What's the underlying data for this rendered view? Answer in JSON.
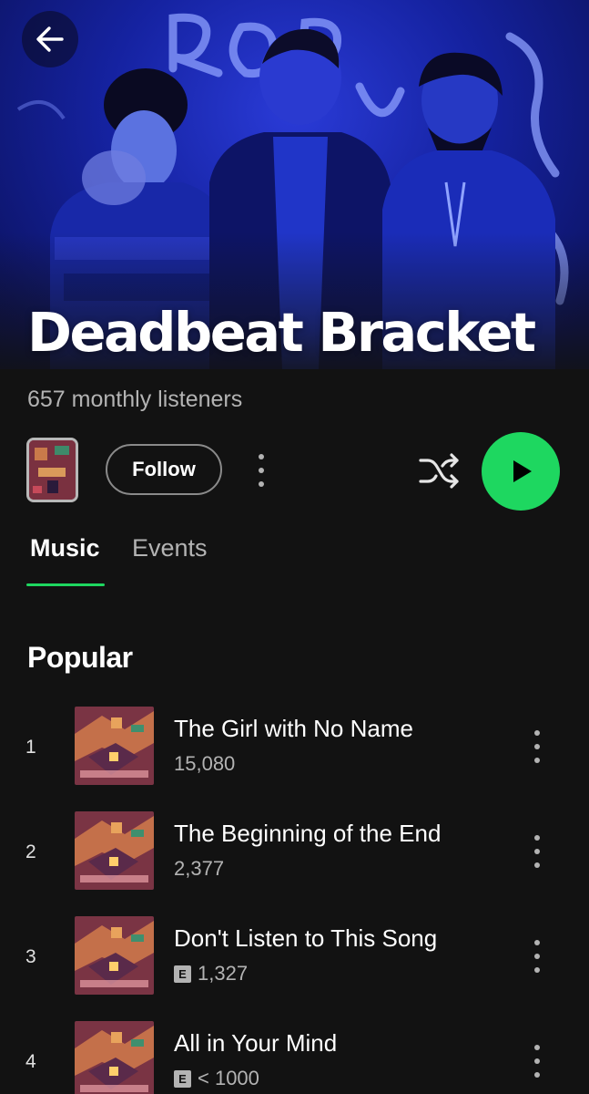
{
  "artist": {
    "name": "Deadbeat Bracket",
    "monthly_listeners": "657 monthly listeners"
  },
  "controls": {
    "follow_label": "Follow"
  },
  "icons": {
    "back": "arrow-left-icon",
    "more": "more-vertical-icon",
    "shuffle": "shuffle-icon",
    "play": "play-icon"
  },
  "tabs": [
    {
      "label": "Music",
      "active": true
    },
    {
      "label": "Events",
      "active": false
    }
  ],
  "popular": {
    "title": "Popular",
    "tracks": [
      {
        "rank": "1",
        "title": "The Girl with No Name",
        "plays": "15,080",
        "explicit": false
      },
      {
        "rank": "2",
        "title": "The Beginning of the End",
        "plays": "2,377",
        "explicit": false
      },
      {
        "rank": "3",
        "title": "Don't Listen to This Song",
        "plays": "1,327",
        "explicit": true,
        "explicit_label": "E"
      },
      {
        "rank": "4",
        "title": "All in Your Mind",
        "plays": "< 1000",
        "explicit": true,
        "explicit_label": "E"
      }
    ]
  },
  "colors": {
    "background": "#121212",
    "accent_green": "#1ed760",
    "secondary_text": "#b3b3b3",
    "hero_blue": "#1a2ac0"
  }
}
